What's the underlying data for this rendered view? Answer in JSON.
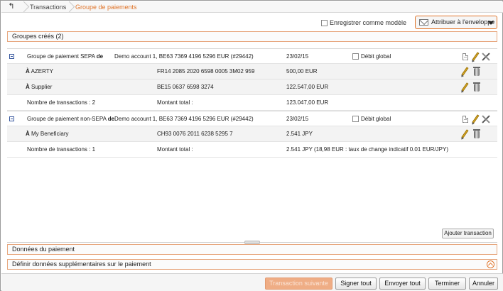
{
  "breadcrumb": {
    "back_icon": "back-arrow-icon",
    "items": [
      "Transactions",
      "Groupe de paiements"
    ]
  },
  "toolbar": {
    "save_template_label": "Enregistrer comme modèle",
    "assign_envelope_label": "Attribuer à l'enveloppe"
  },
  "sections": {
    "groups_title": "Groupes créés (2)",
    "payment_data_title": "Données du paiement",
    "extra_data_title": "Définir données supplémentaires sur le paiement"
  },
  "groups": [
    {
      "title": "Groupe de paiement SEPA",
      "de_label": "de",
      "account": "Demo account 1, BE63 7369 4196 5296 EUR (#29442)",
      "date": "23/02/15",
      "global_debit_label": "Débit global",
      "beneficiaries": [
        {
          "prefix": "À",
          "name": "AZERTY",
          "iban": "FR14 2085 2020 6598 0005 3M02 959",
          "amount": "500,00 EUR"
        },
        {
          "prefix": "À",
          "name": "Supplier",
          "iban": "BE15 0637 6598 3274",
          "amount": "122.547,00 EUR"
        }
      ],
      "tx_count_label": "Nombre de transactions : 2",
      "total_label": "Montant total :",
      "total_amount": "123.047,00 EUR"
    },
    {
      "title": "Groupe de paiement non-SEPA",
      "de_label": "de",
      "account": "Demo account 1, BE63 7369 4196 5296 EUR (#29442)",
      "date": "23/02/15",
      "global_debit_label": "Débit global",
      "beneficiaries": [
        {
          "prefix": "À",
          "name": "My Beneficiary",
          "iban": "CH93 0076 2011 6238 5295 7",
          "amount": "2.541 JPY"
        }
      ],
      "tx_count_label": "Nombre de transactions : 1",
      "total_label": "Montant total :",
      "total_amount": "2.541 JPY (18,98 EUR : taux de change indicatif 0.01 EUR/JPY)"
    }
  ],
  "actions": {
    "add_transaction": "Ajouter transaction",
    "next_transaction": "Transaction suivante",
    "sign_all": "Signer tout",
    "send_all": "Envoyer tout",
    "finish": "Terminer",
    "cancel": "Annuler"
  },
  "colors": {
    "accent": "#e0752b",
    "disabled_button": "#efad85"
  }
}
